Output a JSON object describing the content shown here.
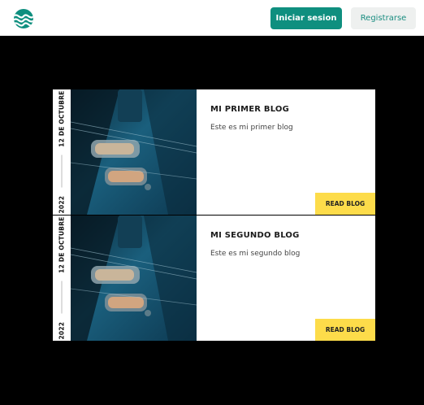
{
  "header": {
    "logo_icon": "waves-icon",
    "login_label": "Iniciar sesion",
    "register_label": "Registrarse"
  },
  "colors": {
    "brand": "#0f8f7f",
    "accent": "#fddc4a",
    "background": "#000000"
  },
  "posts": [
    {
      "date_day": "12 DE OCTUBRE",
      "date_year": "2022",
      "title": "MI PRIMER BLOG",
      "excerpt": "Este es mi primer blog",
      "read_label": "READ BLOG",
      "image_icon": "guitar-photo"
    },
    {
      "date_day": "12 DE OCTUBRE",
      "date_year": "2022",
      "title": "MI SEGUNDO BLOG",
      "excerpt": "Este es mi segundo blog",
      "read_label": "READ BLOG",
      "image_icon": "guitar-photo"
    }
  ]
}
